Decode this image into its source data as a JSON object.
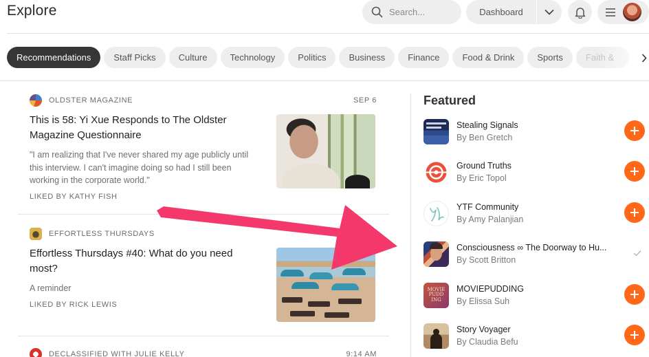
{
  "header": {
    "title": "Explore",
    "search_placeholder": "Search...",
    "dashboard_label": "Dashboard"
  },
  "categories": [
    {
      "label": "Recommendations",
      "active": true
    },
    {
      "label": "Staff Picks"
    },
    {
      "label": "Culture"
    },
    {
      "label": "Technology"
    },
    {
      "label": "Politics"
    },
    {
      "label": "Business"
    },
    {
      "label": "Finance"
    },
    {
      "label": "Food & Drink"
    },
    {
      "label": "Sports"
    },
    {
      "label": "Faith &"
    }
  ],
  "posts": [
    {
      "publication": "OLDSTER MAGAZINE",
      "date": "SEP 6",
      "title": "This is 58: Yi Xue Responds to The Oldster Magazine Questionnaire",
      "subtitle": "\"I am realizing that I've never shared my age publicly until this interview. I can't imagine doing so had I still been working in the corporate world.\"",
      "liked_by": "LIKED BY KATHY FISH"
    },
    {
      "publication": "EFFORTLESS THURSDAYS",
      "date": "",
      "title": "Effortless Thursdays #40: What do you need most?",
      "subtitle": "A reminder",
      "liked_by": "LIKED BY RICK LEWIS"
    },
    {
      "publication": "DECLASSIFIED WITH JULIE KELLY",
      "date": "9:14 AM"
    }
  ],
  "featured": {
    "title": "Featured",
    "items": [
      {
        "name": "Stealing Signals",
        "author": "By Ben Gretch",
        "subscribed": false
      },
      {
        "name": "Ground Truths",
        "author": "By Eric Topol",
        "subscribed": false
      },
      {
        "name": "YTF Community",
        "author": "By Amy Palanjian",
        "subscribed": false
      },
      {
        "name": "Consciousness ∞ The Doorway to Hu...",
        "author": "By Scott Britton",
        "subscribed": true
      },
      {
        "name": "MOVIEPUDDING",
        "author": "By Elissa Suh",
        "subscribed": false,
        "logo_text": "MOVIE PUDD ING"
      },
      {
        "name": "Story Voyager",
        "author": "By Claudia Befu",
        "subscribed": false
      }
    ]
  },
  "colors": {
    "accent": "#ff6719",
    "annotation_arrow": "#f5386b",
    "active_chip": "#363636"
  }
}
